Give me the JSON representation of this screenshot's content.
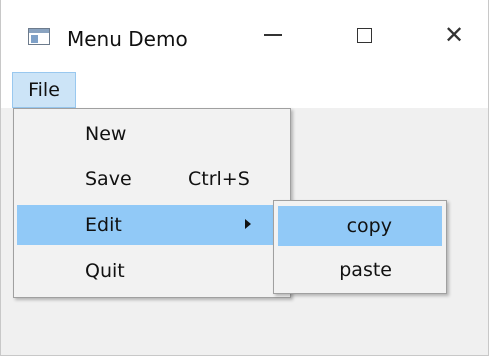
{
  "window": {
    "title": "Menu Demo",
    "icon": "window-app-icon",
    "controls": {
      "minimize_icon": "minimize-icon",
      "maximize_icon": "maximize-icon",
      "close_glyph": "✕"
    }
  },
  "menubar": {
    "items": [
      {
        "label": "File",
        "active": true
      }
    ]
  },
  "file_menu": {
    "items": [
      {
        "label": "New",
        "shortcut": ""
      },
      {
        "label": "Save",
        "shortcut": "Ctrl+S"
      },
      {
        "label": "Edit",
        "shortcut": "",
        "has_submenu": true,
        "highlighted": true
      },
      {
        "label": "Quit",
        "shortcut": ""
      }
    ]
  },
  "edit_submenu": {
    "items": [
      {
        "label": "copy",
        "highlighted": true
      },
      {
        "label": "paste",
        "highlighted": false
      }
    ]
  },
  "colors": {
    "highlight": "#91c9f7",
    "menubar_active": "#cce4f7",
    "menu_bg": "#f2f2f2",
    "client_bg": "#f0f0f0"
  }
}
